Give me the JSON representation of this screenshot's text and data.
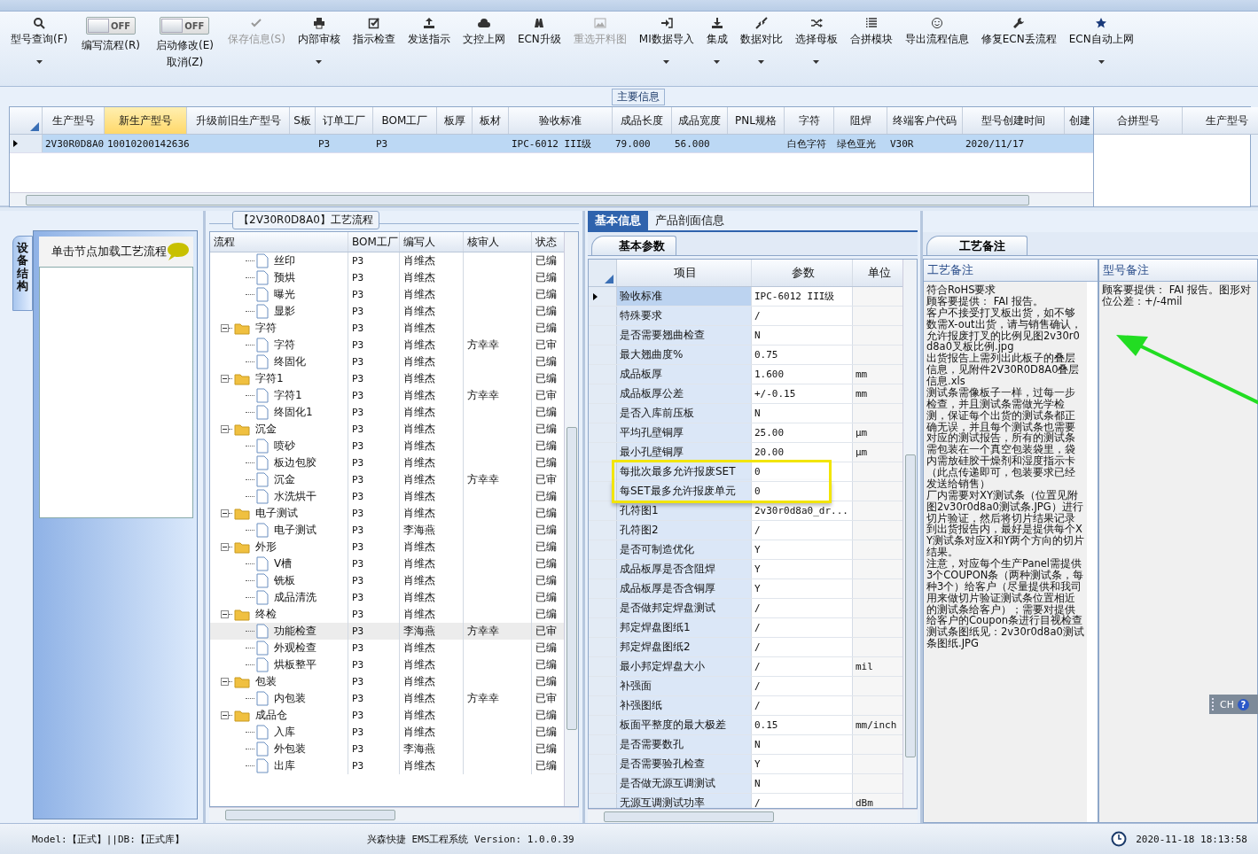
{
  "toolbar": [
    {
      "kind": "button",
      "label": "型号查询(F)",
      "dropdown": true,
      "disabled": false
    },
    {
      "kind": "toggle",
      "switch_text": "OFF",
      "on": false,
      "lines": [
        "编写流程(R)"
      ]
    },
    {
      "kind": "toggle",
      "switch_text": "OFF",
      "on": false,
      "lines": [
        "启动修改(E)",
        "取消(Z)"
      ]
    },
    {
      "kind": "button",
      "label": "保存信息(S)",
      "dropdown": false,
      "disabled": true
    },
    {
      "kind": "button",
      "label": "内部审核",
      "dropdown": true,
      "disabled": false
    },
    {
      "kind": "button",
      "label": "指示检查",
      "dropdown": false,
      "disabled": false
    },
    {
      "kind": "button",
      "label": "发送指示",
      "dropdown": false,
      "disabled": false
    },
    {
      "kind": "button",
      "label": "文控上网",
      "dropdown": false,
      "disabled": false
    },
    {
      "kind": "button",
      "label": "ECN升级",
      "dropdown": false,
      "disabled": false
    },
    {
      "kind": "button",
      "label": "重选开料图",
      "dropdown": false,
      "disabled": true
    },
    {
      "kind": "button",
      "label": "MI数据导入",
      "dropdown": true,
      "disabled": false
    },
    {
      "kind": "button",
      "label": "集成",
      "dropdown": true,
      "disabled": false
    },
    {
      "kind": "button",
      "label": "数据对比",
      "dropdown": true,
      "disabled": false
    },
    {
      "kind": "button",
      "label": "选择母板",
      "dropdown": true,
      "disabled": false
    },
    {
      "kind": "button",
      "label": "合拼模块",
      "dropdown": false,
      "disabled": false
    },
    {
      "kind": "button",
      "label": "导出流程信息",
      "dropdown": false,
      "disabled": false
    },
    {
      "kind": "button",
      "label": "修复ECN丢流程",
      "dropdown": false,
      "disabled": false
    },
    {
      "kind": "button",
      "label": "ECN自动上网",
      "dropdown": true,
      "disabled": false
    }
  ],
  "main_info": {
    "title": "主要信息",
    "columns": [
      {
        "label": "生产型号",
        "selected": false
      },
      {
        "label": "新生产型号",
        "selected": true
      },
      {
        "label": "升级前旧生产型号",
        "selected": false
      },
      {
        "label": "S板",
        "selected": false
      },
      {
        "label": "订单工厂",
        "selected": false
      },
      {
        "label": "BOM工厂",
        "selected": false
      },
      {
        "label": "板厚",
        "selected": false
      },
      {
        "label": "板材",
        "selected": false
      },
      {
        "label": "验收标准",
        "selected": false
      },
      {
        "label": "成品长度",
        "selected": false
      },
      {
        "label": "成品宽度",
        "selected": false
      },
      {
        "label": "PNL规格",
        "selected": false
      },
      {
        "label": "字符",
        "selected": false
      },
      {
        "label": "阻焊",
        "selected": false
      },
      {
        "label": "终端客户代码",
        "selected": false
      },
      {
        "label": "型号创建时间",
        "selected": false
      },
      {
        "label": "创建",
        "selected": false
      }
    ],
    "rows": [
      {
        "selected": true,
        "cells": [
          "2V30R0D8A0",
          "10010200142636",
          null,
          null,
          "P3",
          "P3",
          null,
          null,
          "IPC-6012 III级",
          "79.000",
          "56.000",
          null,
          "白色字符",
          "绿色亚光",
          "V30R",
          "2020/11/17",
          null
        ]
      }
    ],
    "side_columns": [
      "合拼型号",
      "生产型号"
    ]
  },
  "left_panel": {
    "tab": "设备结构",
    "hint": "单击节点加载工艺流程"
  },
  "flow": {
    "title": "【2V30R0D8A0】工艺流程",
    "columns": [
      "流程",
      "BOM工厂",
      "编写人",
      "核审人",
      "状态"
    ],
    "tree": [
      {
        "children": [
          {
            "name": "丝印",
            "bom": "P3",
            "writer": "肖维杰",
            "status": "已编",
            "selected": false
          },
          {
            "name": "预烘",
            "bom": "P3",
            "writer": "肖维杰",
            "status": "已编",
            "selected": false
          },
          {
            "name": "曝光",
            "bom": "P3",
            "writer": "肖维杰",
            "status": "已编",
            "selected": false
          },
          {
            "name": "显影",
            "bom": "P3",
            "writer": "肖维杰",
            "status": "已编",
            "selected": false
          }
        ]
      },
      {
        "name": "字符",
        "bom": "P3",
        "writer": "肖维杰",
        "status": "已编",
        "selected": false,
        "expanded": true,
        "children": [
          {
            "name": "字符",
            "bom": "P3",
            "writer": "肖维杰",
            "reviewer": "方幸幸",
            "status": "已审",
            "selected": false
          },
          {
            "name": "终固化",
            "bom": "P3",
            "writer": "肖维杰",
            "status": "已编",
            "selected": false
          }
        ]
      },
      {
        "name": "字符1",
        "bom": "P3",
        "writer": "肖维杰",
        "status": "已编",
        "selected": false,
        "expanded": true,
        "children": [
          {
            "name": "字符1",
            "bom": "P3",
            "writer": "肖维杰",
            "reviewer": "方幸幸",
            "status": "已审",
            "selected": false
          },
          {
            "name": "终固化1",
            "bom": "P3",
            "writer": "肖维杰",
            "status": "已编",
            "selected": false
          }
        ]
      },
      {
        "name": "沉金",
        "bom": "P3",
        "writer": "肖维杰",
        "status": "已编",
        "selected": false,
        "expanded": true,
        "children": [
          {
            "name": "喷砂",
            "bom": "P3",
            "writer": "肖维杰",
            "status": "已编",
            "selected": false
          },
          {
            "name": "板边包胶",
            "bom": "P3",
            "writer": "肖维杰",
            "status": "已编",
            "selected": false
          },
          {
            "name": "沉金",
            "bom": "P3",
            "writer": "肖维杰",
            "reviewer": "方幸幸",
            "status": "已审",
            "selected": false
          },
          {
            "name": "水洗烘干",
            "bom": "P3",
            "writer": "肖维杰",
            "status": "已编",
            "selected": false
          }
        ]
      },
      {
        "name": "电子测试",
        "bom": "P3",
        "writer": "肖维杰",
        "status": "已编",
        "selected": false,
        "expanded": true,
        "children": [
          {
            "name": "电子测试",
            "bom": "P3",
            "writer": "李海燕",
            "status": "已编",
            "selected": false
          }
        ]
      },
      {
        "name": "外形",
        "bom": "P3",
        "writer": "肖维杰",
        "status": "已编",
        "selected": false,
        "expanded": true,
        "children": [
          {
            "name": "V槽",
            "bom": "P3",
            "writer": "肖维杰",
            "status": "已编",
            "selected": false
          },
          {
            "name": "铣板",
            "bom": "P3",
            "writer": "肖维杰",
            "status": "已编",
            "selected": false
          },
          {
            "name": "成品清洗",
            "bom": "P3",
            "writer": "肖维杰",
            "status": "已编",
            "selected": false
          }
        ]
      },
      {
        "name": "终检",
        "bom": "P3",
        "writer": "肖维杰",
        "status": "已编",
        "selected": false,
        "expanded": true,
        "children": [
          {
            "name": "功能检查",
            "bom": "P3",
            "writer": "李海燕",
            "reviewer": "方幸幸",
            "status": "已审",
            "selected": true
          },
          {
            "name": "外观检查",
            "bom": "P3",
            "writer": "肖维杰",
            "status": "已编",
            "selected": false
          },
          {
            "name": "烘板整平",
            "bom": "P3",
            "writer": "肖维杰",
            "status": "已编",
            "selected": false
          }
        ]
      },
      {
        "name": "包装",
        "bom": "P3",
        "writer": "肖维杰",
        "status": "已编",
        "selected": false,
        "expanded": true,
        "children": [
          {
            "name": "内包装",
            "bom": "P3",
            "writer": "肖维杰",
            "reviewer": "方幸幸",
            "status": "已审",
            "selected": false
          }
        ]
      },
      {
        "name": "成品仓",
        "bom": "P3",
        "writer": "肖维杰",
        "status": "已编",
        "selected": false,
        "expanded": true,
        "children": [
          {
            "name": "入库",
            "bom": "P3",
            "writer": "肖维杰",
            "status": "已编",
            "selected": false
          },
          {
            "name": "外包装",
            "bom": "P3",
            "writer": "李海燕",
            "status": "已编",
            "selected": false
          },
          {
            "name": "出库",
            "bom": "P3",
            "writer": "肖维杰",
            "status": "已编",
            "selected": false
          }
        ]
      }
    ]
  },
  "params": {
    "tabs": [
      {
        "label": "基本信息",
        "selected": true
      },
      {
        "label": "产品剖面信息",
        "selected": false
      }
    ],
    "subtab": "基本参数",
    "columns": [
      "项目",
      "参数",
      "单位"
    ],
    "rows": [
      {
        "item": "验收标准",
        "value": "IPC-6012 III级",
        "selected": true,
        "boxed": false
      },
      {
        "item": "特殊要求",
        "value": "/",
        "selected": false,
        "boxed": false
      },
      {
        "item": "是否需要翘曲检查",
        "value": "N",
        "selected": false,
        "boxed": false
      },
      {
        "item": "最大翘曲度%",
        "value": "0.75",
        "selected": false,
        "boxed": false
      },
      {
        "item": "成品板厚",
        "value": "1.600",
        "unit": "mm",
        "selected": false,
        "boxed": false
      },
      {
        "item": "成品板厚公差",
        "value": "+/-0.15",
        "unit": "mm",
        "selected": false,
        "boxed": false
      },
      {
        "item": "是否入库前压板",
        "value": "N",
        "selected": false,
        "boxed": false
      },
      {
        "item": "平均孔壁铜厚",
        "value": "25.00",
        "unit": "μm",
        "selected": false,
        "boxed": false
      },
      {
        "item": "最小孔壁铜厚",
        "value": "20.00",
        "unit": "μm",
        "selected": false,
        "boxed": false
      },
      {
        "item": "每批次最多允许报废SET",
        "value": "0",
        "selected": false,
        "boxed": true
      },
      {
        "item": "每SET最多允许报废单元",
        "value": "0",
        "selected": false,
        "boxed": true
      },
      {
        "item": "孔符图1",
        "value": "2v30r0d8a0_dr...",
        "selected": false,
        "boxed": false
      },
      {
        "item": "孔符图2",
        "value": "/",
        "selected": false,
        "boxed": false
      },
      {
        "item": "是否可制造优化",
        "value": "Y",
        "selected": false,
        "boxed": false
      },
      {
        "item": "成品板厚是否含阻焊",
        "value": "Y",
        "selected": false,
        "boxed": false
      },
      {
        "item": "成品板厚是否含铜厚",
        "value": "Y",
        "selected": false,
        "boxed": false
      },
      {
        "item": "是否做邦定焊盘测试",
        "value": "/",
        "selected": false,
        "boxed": false
      },
      {
        "item": "邦定焊盘图纸1",
        "value": "/",
        "selected": false,
        "boxed": false
      },
      {
        "item": "邦定焊盘图纸2",
        "value": "/",
        "selected": false,
        "boxed": false
      },
      {
        "item": "最小邦定焊盘大小",
        "value": "/",
        "unit": "mil",
        "selected": false,
        "boxed": false
      },
      {
        "item": "补强面",
        "value": "/",
        "selected": false,
        "boxed": false
      },
      {
        "item": "补强图纸",
        "value": "/",
        "selected": false,
        "boxed": false
      },
      {
        "item": "板面平整度的最大极差",
        "value": "0.15",
        "unit": "mm/inch",
        "selected": false,
        "boxed": false
      },
      {
        "item": "是否需要数孔",
        "value": "N",
        "selected": false,
        "boxed": false
      },
      {
        "item": "是否需要验孔检查",
        "value": "Y",
        "selected": false,
        "boxed": false
      },
      {
        "item": "是否做无源互调测试",
        "value": "N",
        "selected": false,
        "boxed": false
      },
      {
        "item": "无源互调测试功率",
        "value": "/",
        "unit": "dBm",
        "selected": false,
        "boxed": false
      }
    ]
  },
  "notes": {
    "tab": "工艺备注",
    "process_title": "工艺备注",
    "process_notes": [
      "符合RoHS要求",
      "顾客要提供： FAI 报告。",
      "客户不接受打叉板出货，如不够数需X-out出货，请与销售确认，允许报废打叉的比例见图2v30r0d8a0叉板比例.jpg",
      "出货报告上需列出此板子的叠层信息，见附件2V30R0D8A0叠层信息.xls",
      "测试条需像板子一样，过每一步检查，并且测试条需做光学检测，保证每个出货的测试条都正确无误，并且每个测试条也需要对应的测试报告，所有的测试条需包装在一个真空包装袋里，袋内需放硅胶干燥剂和湿度指示卡（此点传递即可，包装要求已经发送给销售）",
      "厂内需要对XY测试条（位置见附图2v30r0d8a0测试条.JPG）进行切片验证，然后将切片结果记录到出货报告内，最好是提供每个XY测试条对应X和Y两个方向的切片结果。",
      "注意，对应每个生产Panel需提供3个COUPON条（两种测试条，每种3个）给客户（尽量提供和我司用来做切片验证测试条位置相近的测试条给客户）；需要对提供给客户的Coupon条进行目视检查",
      "测试条图纸见：2v30r0d8a0测试条图纸.JPG"
    ],
    "model_title": "型号备注",
    "model_notes": [
      "顾客要提供： FAI 报告。图形对位公差：+/-4mil"
    ]
  },
  "language_bar": {
    "code": "CH",
    "help": "?"
  },
  "status_bar": {
    "mode": "Model:【正式】||DB:【正式库】",
    "app": "兴森快捷 EMS工程系统 Version: 1.0.0.39",
    "datetime": "2020-11-18 18:13:58"
  }
}
